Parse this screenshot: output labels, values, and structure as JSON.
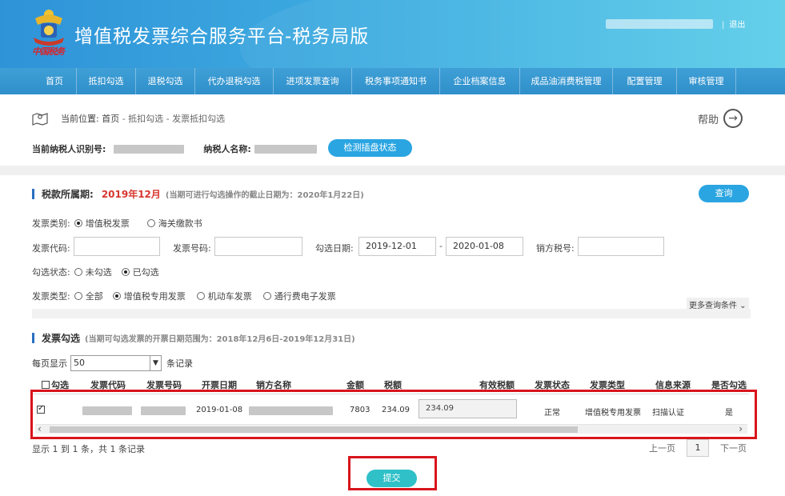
{
  "header": {
    "title": "增值税发票综合服务平台",
    "subtitle": "-税务局版",
    "brand_text": "中国税务",
    "logout": "退出",
    "separator": "|"
  },
  "nav": {
    "items": [
      {
        "label": "首页"
      },
      {
        "label": "抵扣勾选"
      },
      {
        "label": "退税勾选"
      },
      {
        "label": "代办退税勾选"
      },
      {
        "label": "进项发票查询"
      },
      {
        "label": "税务事项通知书"
      },
      {
        "label": "企业档案信息"
      },
      {
        "label": "成品油消费税管理"
      },
      {
        "label": "配置管理"
      },
      {
        "label": "审核管理"
      }
    ]
  },
  "location": {
    "prefix": "当前位置:",
    "home": "首页",
    "path": " - 抵扣勾选 - 发票抵扣勾选",
    "help": "帮助"
  },
  "taxpayer": {
    "id_label": "当前纳税人识别号:",
    "name_label": "纳税人名称:",
    "detect_button": "检测插盘状态"
  },
  "period_section": {
    "title": "税款所属期:",
    "period": "2019年12月",
    "hint": "(当期可进行勾选操作的截止日期为：2020年1月22日)",
    "query_button": "查询"
  },
  "filters": {
    "invoice_category_label": "发票类别:",
    "invoice_category_options": [
      "增值税发票",
      "海关缴款书"
    ],
    "invoice_code_label": "发票代码:",
    "invoice_number_label": "发票号码:",
    "select_date_label": "勾选日期:",
    "date_from": "2019-12-01",
    "date_sep": "-",
    "date_to": "2020-01-08",
    "seller_tax_no_label": "销方税号:",
    "check_status_label": "勾选状态:",
    "check_status_options": [
      "未勾选",
      "已勾选"
    ],
    "invoice_type_label": "发票类型:",
    "invoice_type_options": [
      "全部",
      "增值税专用发票",
      "机动车发票",
      "通行费电子发票"
    ],
    "more_conditions": "更多查询条件"
  },
  "invoice_section": {
    "title": "发票勾选",
    "hint": "(当期可勾选发票的开票日期范围为：2018年12月6日-2019年12月31日)",
    "page_size_prefix": "每页显示",
    "page_size": "50",
    "page_size_suffix": "条记录",
    "columns": [
      "勾选",
      "发票代码",
      "发票号码",
      "开票日期",
      "销方名称",
      "金额",
      "税额",
      "有效税额",
      "发票状态",
      "发票类型",
      "信息来源",
      "是否勾选"
    ],
    "rows": [
      {
        "checked": true,
        "date": "2019-01-08",
        "amount": "7803",
        "tax": "234.09",
        "valid_tax": "234.09",
        "status": "正常",
        "type": "增值税专用发票",
        "source": "扫描认证",
        "selected": "是"
      }
    ],
    "summary": "显示 1 到 1 条，共 1 条记录",
    "prev": "上一页",
    "page": "1",
    "next": "下一页",
    "submit": "提交"
  }
}
